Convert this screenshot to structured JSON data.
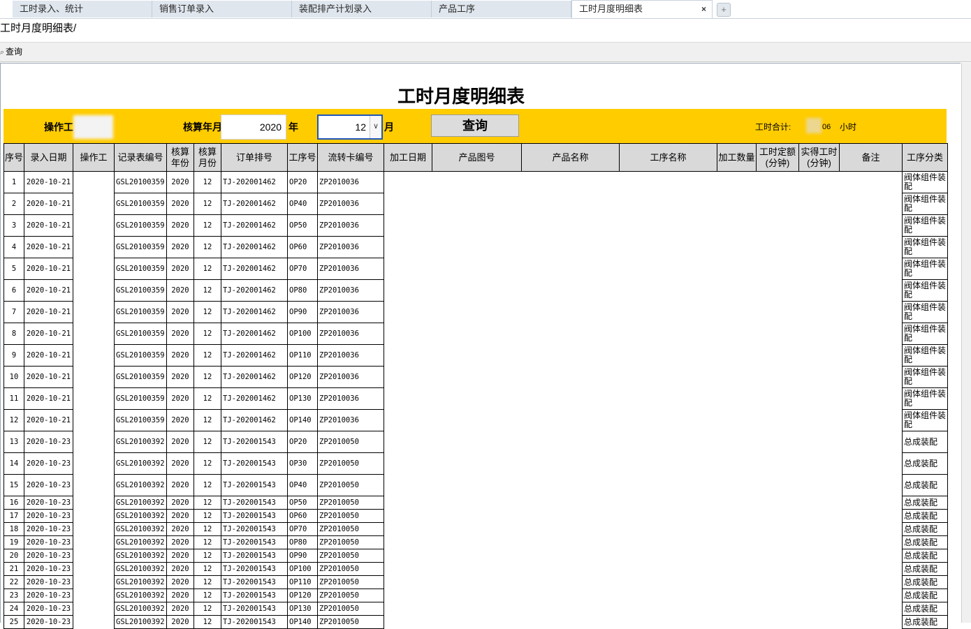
{
  "tabs": [
    {
      "label": "工时录入、统计"
    },
    {
      "label": "销售订单录入"
    },
    {
      "label": "装配排产计划录入"
    },
    {
      "label": "产品工序"
    },
    {
      "label": "工时月度明细表"
    }
  ],
  "tab_close": "×",
  "tab_add": "+",
  "breadcrumb": "工时月度明细表/",
  "toolbar": {
    "query_label": "查询"
  },
  "report": {
    "title": "工时月度明细表",
    "filters": {
      "operator_label": "操作工",
      "period_label": "核算年月",
      "year_value": "2020",
      "year_unit": "年",
      "month_value": "12",
      "month_unit": "月",
      "query_button": "查询",
      "total_label": "工时合计:",
      "total_value": "06",
      "total_unit": "小时"
    }
  },
  "table": {
    "columns": [
      "序号",
      "录入日期",
      "操作工",
      "记录表编号",
      "核算年份",
      "核算月份",
      "订单排号",
      "工序号",
      "流转卡编号",
      "加工日期",
      "产品图号",
      "产品名称",
      "工序名称",
      "加工数量",
      "工时定额(分钟)",
      "实得工时(分钟)",
      "备注",
      "工序分类"
    ],
    "rows": [
      [
        "1",
        "2020-10-21",
        "GSL20100359",
        "2020",
        "12",
        "TJ-202001462",
        "OP20",
        "ZP2010036",
        "阀体组件装配"
      ],
      [
        "2",
        "2020-10-21",
        "GSL20100359",
        "2020",
        "12",
        "TJ-202001462",
        "OP40",
        "ZP2010036",
        "阀体组件装配"
      ],
      [
        "3",
        "2020-10-21",
        "GSL20100359",
        "2020",
        "12",
        "TJ-202001462",
        "OP50",
        "ZP2010036",
        "阀体组件装配"
      ],
      [
        "4",
        "2020-10-21",
        "GSL20100359",
        "2020",
        "12",
        "TJ-202001462",
        "OP60",
        "ZP2010036",
        "阀体组件装配"
      ],
      [
        "5",
        "2020-10-21",
        "GSL20100359",
        "2020",
        "12",
        "TJ-202001462",
        "OP70",
        "ZP2010036",
        "阀体组件装配"
      ],
      [
        "6",
        "2020-10-21",
        "GSL20100359",
        "2020",
        "12",
        "TJ-202001462",
        "OP80",
        "ZP2010036",
        "阀体组件装配"
      ],
      [
        "7",
        "2020-10-21",
        "GSL20100359",
        "2020",
        "12",
        "TJ-202001462",
        "OP90",
        "ZP2010036",
        "阀体组件装配"
      ],
      [
        "8",
        "2020-10-21",
        "GSL20100359",
        "2020",
        "12",
        "TJ-202001462",
        "OP100",
        "ZP2010036",
        "阀体组件装配"
      ],
      [
        "9",
        "2020-10-21",
        "GSL20100359",
        "2020",
        "12",
        "TJ-202001462",
        "OP110",
        "ZP2010036",
        "阀体组件装配"
      ],
      [
        "10",
        "2020-10-21",
        "GSL20100359",
        "2020",
        "12",
        "TJ-202001462",
        "OP120",
        "ZP2010036",
        "阀体组件装配"
      ],
      [
        "11",
        "2020-10-21",
        "GSL20100359",
        "2020",
        "12",
        "TJ-202001462",
        "OP130",
        "ZP2010036",
        "阀体组件装配"
      ],
      [
        "12",
        "2020-10-21",
        "GSL20100359",
        "2020",
        "12",
        "TJ-202001462",
        "OP140",
        "ZP2010036",
        "阀体组件装配"
      ],
      [
        "13",
        "2020-10-23",
        "GSL20100392",
        "2020",
        "12",
        "TJ-202001543",
        "OP20",
        "ZP2010050",
        "总成装配"
      ],
      [
        "14",
        "2020-10-23",
        "GSL20100392",
        "2020",
        "12",
        "TJ-202001543",
        "OP30",
        "ZP2010050",
        "总成装配"
      ],
      [
        "15",
        "2020-10-23",
        "GSL20100392",
        "2020",
        "12",
        "TJ-202001543",
        "OP40",
        "ZP2010050",
        "总成装配"
      ],
      [
        "16",
        "2020-10-23",
        "GSL20100392",
        "2020",
        "12",
        "TJ-202001543",
        "OP50",
        "ZP2010050",
        "总成装配"
      ],
      [
        "17",
        "2020-10-23",
        "GSL20100392",
        "2020",
        "12",
        "TJ-202001543",
        "OP60",
        "ZP2010050",
        "总成装配"
      ],
      [
        "18",
        "2020-10-23",
        "GSL20100392",
        "2020",
        "12",
        "TJ-202001543",
        "OP70",
        "ZP2010050",
        "总成装配"
      ],
      [
        "19",
        "2020-10-23",
        "GSL20100392",
        "2020",
        "12",
        "TJ-202001543",
        "OP80",
        "ZP2010050",
        "总成装配"
      ],
      [
        "20",
        "2020-10-23",
        "GSL20100392",
        "2020",
        "12",
        "TJ-202001543",
        "OP90",
        "ZP2010050",
        "总成装配"
      ],
      [
        "21",
        "2020-10-23",
        "GSL20100392",
        "2020",
        "12",
        "TJ-202001543",
        "OP100",
        "ZP2010050",
        "总成装配"
      ],
      [
        "22",
        "2020-10-23",
        "GSL20100392",
        "2020",
        "12",
        "TJ-202001543",
        "OP110",
        "ZP2010050",
        "总成装配"
      ],
      [
        "23",
        "2020-10-23",
        "GSL20100392",
        "2020",
        "12",
        "TJ-202001543",
        "OP120",
        "ZP2010050",
        "总成装配"
      ],
      [
        "24",
        "2020-10-23",
        "GSL20100392",
        "2020",
        "12",
        "TJ-202001543",
        "OP130",
        "ZP2010050",
        "总成装配"
      ],
      [
        "25",
        "2020-10-23",
        "GSL20100392",
        "2020",
        "12",
        "TJ-202001543",
        "OP140",
        "ZP2010050",
        "总成装配"
      ]
    ]
  }
}
